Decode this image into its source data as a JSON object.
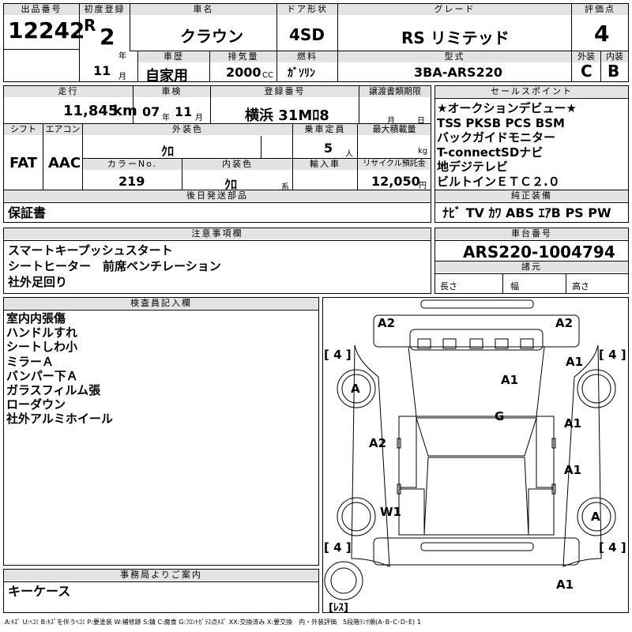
{
  "lot": {
    "label": "出品番号",
    "value": "12242"
  },
  "first_reg": {
    "label": "初度登録",
    "era": "R",
    "year": "2",
    "year_unit": "年",
    "month": "11",
    "month_unit": "月"
  },
  "car_name": {
    "label": "車名",
    "value": "クラウン"
  },
  "door_type": {
    "label": "ドア形状",
    "value": "4SD"
  },
  "grade": {
    "label": "グレード",
    "value": "RS リミテッド"
  },
  "score": {
    "label": "評価点",
    "value": "4"
  },
  "history": {
    "label": "車歴",
    "value": "自家用"
  },
  "displacement": {
    "label": "排気量",
    "value": "2000",
    "unit": "CC"
  },
  "fuel": {
    "label": "燃料",
    "value": "ｶﾞｿﾘﾝ"
  },
  "model": {
    "label": "型式",
    "value": "3BA-ARS220"
  },
  "ext_int": {
    "ext_label": "外装",
    "int_label": "内装",
    "ext": "C",
    "int": "B"
  },
  "mileage": {
    "label": "走行",
    "value": "11,845",
    "unit": "km"
  },
  "inspection": {
    "label": "車検",
    "year": "07",
    "year_unit": "年",
    "month": "11",
    "month_unit": "月"
  },
  "reg_no": {
    "label": "登録番号",
    "value": "横浜 31Mﾛ8"
  },
  "transfer": {
    "label": "譲渡書類期限",
    "month_unit": "月",
    "day_unit": "日"
  },
  "shift": {
    "label": "シフト",
    "value": "FAT"
  },
  "ac": {
    "label": "エアコン",
    "value": "AAC"
  },
  "ext_color": {
    "label": "外装色",
    "value": "ｸﾛ"
  },
  "capacity": {
    "label": "乗車定員",
    "value": "5",
    "unit": "人"
  },
  "max_load": {
    "label": "最大積載量",
    "unit": "kg"
  },
  "color_no": {
    "label": "カラーNo.",
    "value": "219"
  },
  "int_color": {
    "label": "内装色",
    "value": "ｸﾛ",
    "suffix": "系"
  },
  "import": {
    "label": "輸入車"
  },
  "recycle": {
    "label": "リサイクル預託金",
    "value": "12,050",
    "unit": "円"
  },
  "later_parts": {
    "label": "後日発送部品",
    "value": "保証書"
  },
  "sales_points": {
    "label": "セールスポイント",
    "items": [
      "★オークションデビュー★",
      "TSS PKSB PCS BSM",
      "バックガイドモニター",
      "T-connectSDナビ",
      "地デジテレビ",
      "ビルトインＥＴＣ２.０"
    ]
  },
  "equipment": {
    "label": "純正装備",
    "value": "ﾅﾋﾞ TV ｶﾜ ABS ｴｱB PS PW"
  },
  "notes": {
    "label": "注意事項欄",
    "lines": [
      "スマートキープッシュスタート",
      "シートヒーター　前席ベンチレーション",
      "社外足回り"
    ]
  },
  "chassis": {
    "label": "車台番号",
    "value": "ARS220-1004794"
  },
  "specs": {
    "label": "諸元",
    "length": "長さ",
    "width": "幅",
    "height": "高さ"
  },
  "inspector": {
    "label": "検査員記入欄",
    "lines": [
      "室内内張傷",
      "ハンドルすれ",
      "シートしわ小",
      "ミラーＡ",
      "バンパー下Ａ",
      "ガラスフィルム張",
      "ローダウン",
      "社外アルミホイール"
    ]
  },
  "office": {
    "label": "事務局よりご案内",
    "value": "キーケース"
  },
  "legend": "A:ｷｽﾞ U:ﾍｺﾐ B:ｷｽﾞを伴うﾍｺﾐ P:要塗装 W:補修跡 S:錆 C:腐食 G:ﾌﾛﾝﾄｶﾞﾗｽ点ｷｽﾞ XX:交換済み X:要交換　内・外装評価　5段階ﾗﾝｸ順(A･B･C･D･E) 1",
  "diagram": {
    "tire_depth": "4",
    "spare_label": "ﾚｽ",
    "marks": {
      "front_left": "A2",
      "front_right": "A2",
      "fender_left": "A",
      "fender_right": "A1",
      "hood": "A1",
      "windshield": "G",
      "front_door_left": "A2",
      "front_door_right": "A1",
      "rear_door_right": "A1",
      "rear_wheel_left": "W1",
      "rear_fender_right": "A",
      "rear_bumper": "A1"
    }
  }
}
